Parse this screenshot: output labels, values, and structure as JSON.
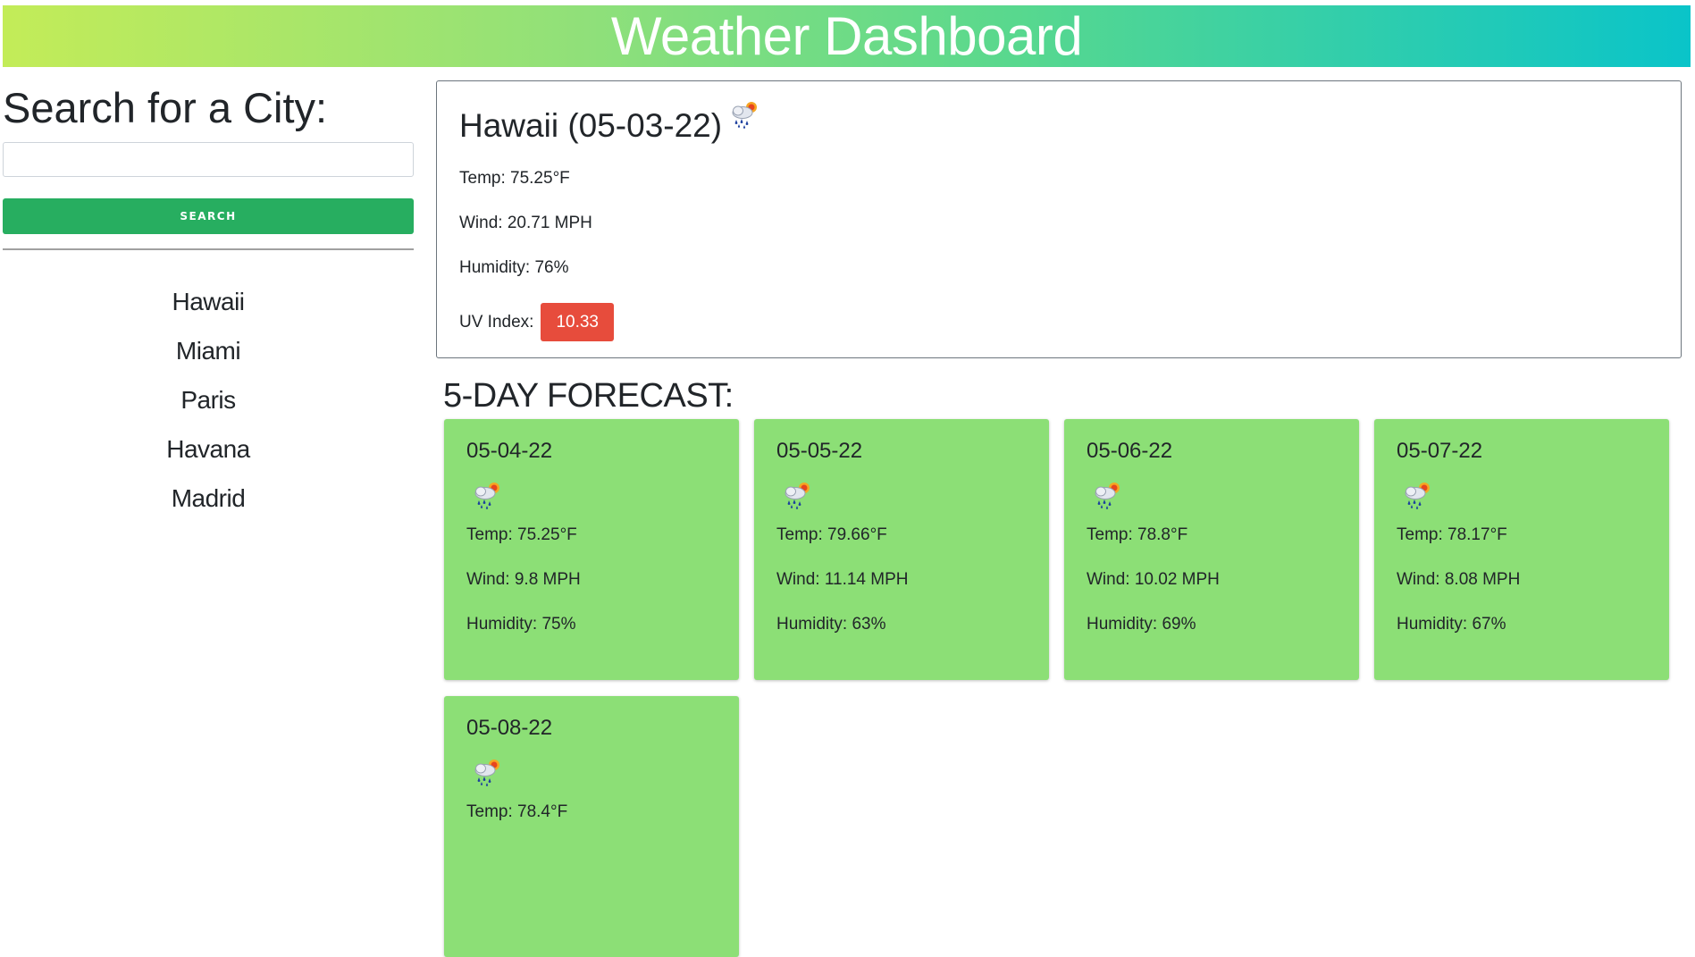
{
  "header": {
    "title": "Weather Dashboard"
  },
  "sidebar": {
    "search_title": "Search for a City:",
    "search_placeholder": "",
    "search_value": "",
    "search_button": "SEARCH",
    "history": [
      "Hawaii",
      "Miami",
      "Paris",
      "Havana",
      "Madrid"
    ]
  },
  "current": {
    "title": "Hawaii (05-03-22)",
    "icon": "rain-sun-icon",
    "temp": "Temp: 75.25°F",
    "wind": "Wind: 20.71 MPH",
    "humidity": "Humidity: 76%",
    "uv_label": "UV Index:",
    "uv_value": "10.33",
    "uv_color": "#e74c3c"
  },
  "forecast": {
    "heading": "5-DAY FORECAST:",
    "card_color": "#8cdf76",
    "days": [
      {
        "date": "05-04-22",
        "icon": "rain-sun-icon",
        "temp": "Temp: 75.25°F",
        "wind": "Wind: 9.8 MPH",
        "humidity": "Humidity: 75%"
      },
      {
        "date": "05-05-22",
        "icon": "rain-sun-icon",
        "temp": "Temp: 79.66°F",
        "wind": "Wind: 11.14 MPH",
        "humidity": "Humidity: 63%"
      },
      {
        "date": "05-06-22",
        "icon": "rain-sun-icon",
        "temp": "Temp: 78.8°F",
        "wind": "Wind: 10.02 MPH",
        "humidity": "Humidity: 69%"
      },
      {
        "date": "05-07-22",
        "icon": "rain-sun-icon",
        "temp": "Temp: 78.17°F",
        "wind": "Wind: 8.08 MPH",
        "humidity": "Humidity: 67%"
      },
      {
        "date": "05-08-22",
        "icon": "rain-sun-icon",
        "temp": "Temp: 78.4°F",
        "wind": "",
        "humidity": ""
      }
    ]
  }
}
